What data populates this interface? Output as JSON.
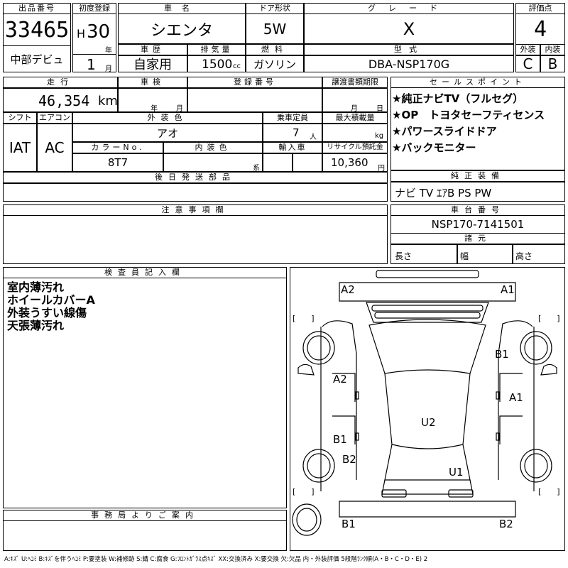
{
  "header": {
    "lot_number_label": "出品番号",
    "lot_number": "33465",
    "first_reg_label": "初度登録",
    "era": "H",
    "year": "30",
    "year_unit": "年",
    "month": "1",
    "month_unit": "月",
    "debut_note": "中部デビュ",
    "car_name_label": "車名",
    "car_name": "シエンタ",
    "door_label": "ドア形状",
    "door": "5W",
    "grade_label": "グレード",
    "grade": "X",
    "score_label": "評価点",
    "score": "4",
    "history_label": "車歴",
    "history": "自家用",
    "displacement_label": "排気量",
    "displacement": "1500",
    "displacement_unit": "cc",
    "fuel_label": "燃料",
    "fuel": "ガソリン",
    "model_label": "型式",
    "model": "DBA-NSP170G",
    "exterior_score_label": "外装",
    "exterior_score": "C",
    "interior_score_label": "内装",
    "interior_score": "B"
  },
  "row2": {
    "mileage_label": "走行",
    "mileage": "46,354",
    "mileage_unit": "km",
    "inspection_label": "車検",
    "inspection_year_unit": "年",
    "inspection_month_unit": "月",
    "plate_label": "登録番号",
    "transfer_label": "譲渡書類期限",
    "transfer_month_unit": "月",
    "transfer_day_unit": "日",
    "shift_label": "シフト",
    "shift": "IAT",
    "ac_label": "エアコン",
    "ac": "AC",
    "ext_color_label": "外装色",
    "ext_color": "アオ",
    "capacity_label": "乗車定員",
    "capacity": "7",
    "capacity_unit": "人",
    "load_label": "最大積載量",
    "load_unit": "kg",
    "color_no_label": "カラーNo.",
    "color_no": "8T7",
    "int_color_label": "内装色",
    "int_color_unit": "系",
    "import_label": "輸入車",
    "recycle_label": "リサイクル預託金",
    "recycle": "10,360",
    "recycle_unit": "円",
    "later_parts_label": "後日発送部品"
  },
  "sales_points": {
    "label": "セールスポイント",
    "items": [
      "★純正ナビTV（フルセグ）",
      "★OP　トヨタセーフティセンス",
      "★パワースライドドア",
      "★バックモニター"
    ]
  },
  "equipment": {
    "label": "純正装備",
    "value": "ナビ TV ｴｱB PS PW"
  },
  "notes": {
    "label": "注意事項欄"
  },
  "chassis": {
    "label": "車台番号",
    "value": "NSP170-7141501",
    "dims_label": "諸元",
    "length_label": "長さ",
    "width_label": "幅",
    "height_label": "高さ"
  },
  "inspector": {
    "label": "検査員記入欄",
    "lines": [
      "室内薄汚れ",
      "ホイールカバーA",
      "外装うすい線傷",
      "天張薄汚れ"
    ]
  },
  "office": {
    "label": "事務局よりご案内"
  },
  "diagram": {
    "marks": {
      "front_left": "A2",
      "front_right": "A1",
      "right_front_fender": "B1",
      "left_front_door": "A2",
      "right_front_door": "A1",
      "left_rear_door": "B1",
      "left_rear_fender": "B2",
      "roof": "U2",
      "rear_glass": "U1",
      "rear_left": "B1",
      "rear_right": "B2"
    },
    "bracket": "[　　]"
  },
  "legend": "A:ｷｽﾞ U:ﾍｺﾐ B:ｷｽﾞを伴うﾍｺﾐ P:要塗装 W:補修跡 S:錆 C:腐食 G:ﾌﾛﾝﾄｶﾞﾗｽ点ｷｽﾞ XX:交換済み X:要交換 欠:欠品 内・外装評価 5段階ﾗﾝｸ順(A・B・C・D・E) 2"
}
